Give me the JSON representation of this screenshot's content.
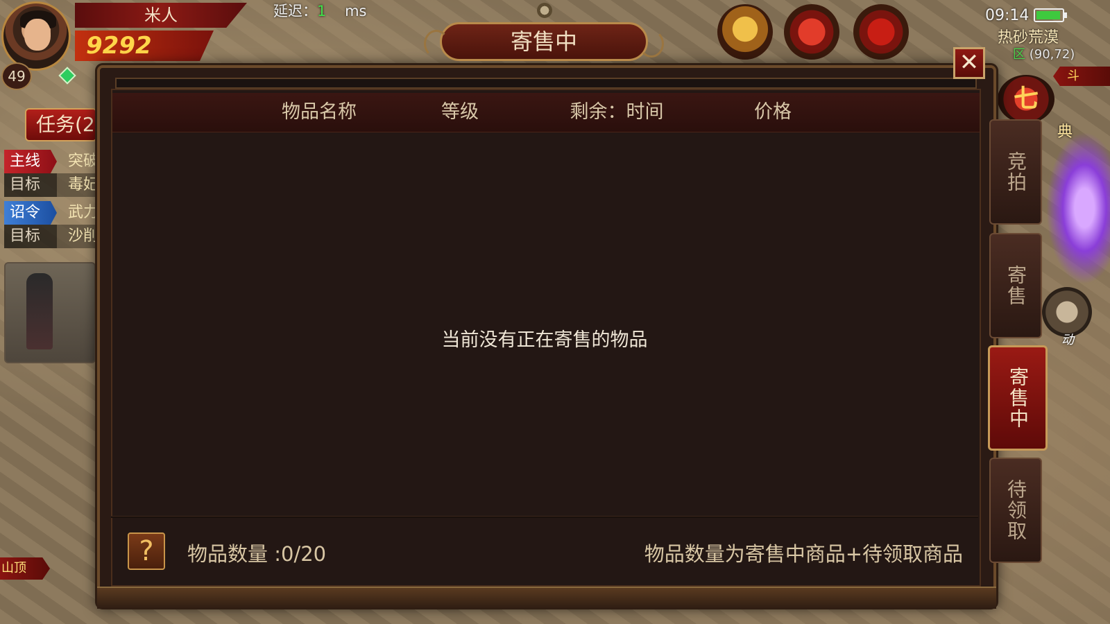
{
  "hud": {
    "player_name": "米人",
    "power_value": "9292",
    "level": "49",
    "latency_label": "延迟：",
    "latency_value": "1",
    "latency_unit": "ms",
    "time": "09:14",
    "map_name": "热砂荒漠",
    "zone_mark": "区",
    "coords": "(90,72)",
    "right_tag": "斗",
    "right_label_dian": "典",
    "right_round_glyph": "七",
    "helmet_label": "动",
    "mountain_tag": "山顶"
  },
  "quest": {
    "tab_label": "任务(2",
    "rows": [
      {
        "tag": "主线",
        "value": "突破",
        "style": "red"
      },
      {
        "tag": "目标",
        "value": "毒妃",
        "style": "plain"
      },
      {
        "tag": "诏令",
        "value": "武力",
        "style": "blue"
      },
      {
        "tag": "目标",
        "value": "沙削",
        "style": "plain"
      }
    ]
  },
  "dialog": {
    "title": "寄售中",
    "close_glyph": "✕",
    "columns": [
      "物品名称",
      "等级",
      "剩余：时间",
      "价格"
    ],
    "empty_message": "当前没有正在寄售的物品",
    "help_glyph": "?",
    "item_count_label": "物品数量 :0/20",
    "note": "物品数量为寄售中商品+待领取商品"
  },
  "side_tabs": [
    {
      "label": "竞拍",
      "active": false
    },
    {
      "label": "寄售",
      "active": false
    },
    {
      "label": "寄售中",
      "active": true
    },
    {
      "label": "待领取",
      "active": false
    }
  ],
  "colors": {
    "panel_bg": "#231714",
    "accent_red": "#8e1a14",
    "gold_border": "#c9a36a",
    "latency_green": "#42e04a"
  }
}
